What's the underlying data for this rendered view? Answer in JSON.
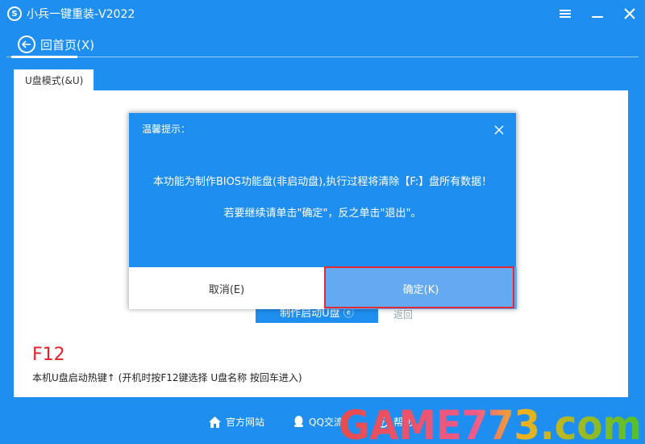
{
  "window": {
    "title": "小兵一键重装-V2022",
    "logo_char": "S"
  },
  "nav": {
    "back_label": "回首页(X)"
  },
  "tab": {
    "label": "U盘模式(&U)"
  },
  "main": {
    "make_button_label": "制作启动U盘 ⓔ",
    "return_label": "返回",
    "hotkey": "F12",
    "hotkey_desc": "本机U盘启动热键↑ (开机时按F12键选择 U盘名称 按回车进入)"
  },
  "footer": {
    "items": [
      {
        "label": "官方网站",
        "icon": "home-icon"
      },
      {
        "label": "QQ交流",
        "icon": "qq-icon"
      },
      {
        "label": "帮助",
        "icon": "help-icon"
      }
    ]
  },
  "dialog": {
    "title": "温馨提示：",
    "message_line1": "本功能为制作BIOS功能盘(非启动盘),执行过程将清除【F:】盘所有数据！",
    "message_line2": "若要继续请单击\"确定\"，反之单击\"退出\"。",
    "cancel_label": "取消(E)",
    "ok_label": "确定(K)"
  },
  "watermark": {
    "text": "GAME773.com"
  },
  "colors": {
    "brand_blue": "#1e8ff0",
    "ok_button": "#63aaf2",
    "highlight_red": "#e32a33",
    "hotkey_red": "#e8202a"
  }
}
